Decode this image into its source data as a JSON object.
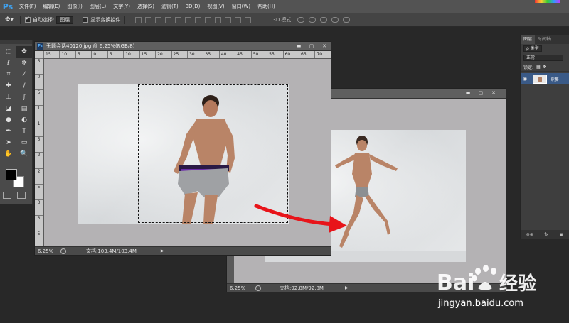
{
  "menubar": {
    "app_logo": "Ps",
    "items": [
      "文件(F)",
      "编辑(E)",
      "图像(I)",
      "图层(L)",
      "文字(Y)",
      "选择(S)",
      "滤镜(T)",
      "3D(D)",
      "视图(V)",
      "窗口(W)",
      "帮助(H)"
    ]
  },
  "options": {
    "auto_select_label": "自动选择:",
    "auto_select_value": "图层",
    "show_transform_label": "显示变换控件",
    "mode_label": "3D 模式:"
  },
  "toolbar": {
    "tools": [
      "move",
      "marquee",
      "lasso",
      "magic-wand",
      "crop",
      "eyedropper",
      "healing",
      "brush",
      "stamp",
      "history-brush",
      "eraser",
      "gradient",
      "blur",
      "dodge",
      "pen",
      "type",
      "path-select",
      "shape",
      "hand",
      "zoom"
    ],
    "foreground_color": "#000000",
    "background_color": "#ffffff"
  },
  "doc1": {
    "title": "无题会话40120.jpg @ 6.25%(RGB/8)",
    "ruler_h": [
      "15",
      "10",
      "5",
      "0",
      "5",
      "10",
      "15",
      "20",
      "25",
      "30",
      "35",
      "40",
      "45",
      "50",
      "55",
      "60",
      "65",
      "70"
    ],
    "ruler_v": [
      "5",
      "0",
      "5",
      "1",
      "1",
      "5",
      "2",
      "2",
      "5",
      "3",
      "3",
      "5"
    ],
    "zoom": "6.25%",
    "doc_info": "文档:103.4M/103.4M"
  },
  "doc2": {
    "zoom": "6.25%",
    "doc_info": "文档:92.8M/92.8M"
  },
  "layers_panel": {
    "tabs": [
      "图层",
      "时间轴"
    ],
    "filter_label": "ρ 类型",
    "blend_mode": "正常",
    "lock_label": "锁定:",
    "layer_name": "背景",
    "footer": [
      "⊖⊕",
      "fx",
      "▣"
    ]
  },
  "watermark": {
    "url": "jingyan.baidu.com"
  },
  "colors": {
    "accent": "#3fa2f0",
    "layer_selected": "#3a5a87",
    "arrow": "#e8141a"
  }
}
